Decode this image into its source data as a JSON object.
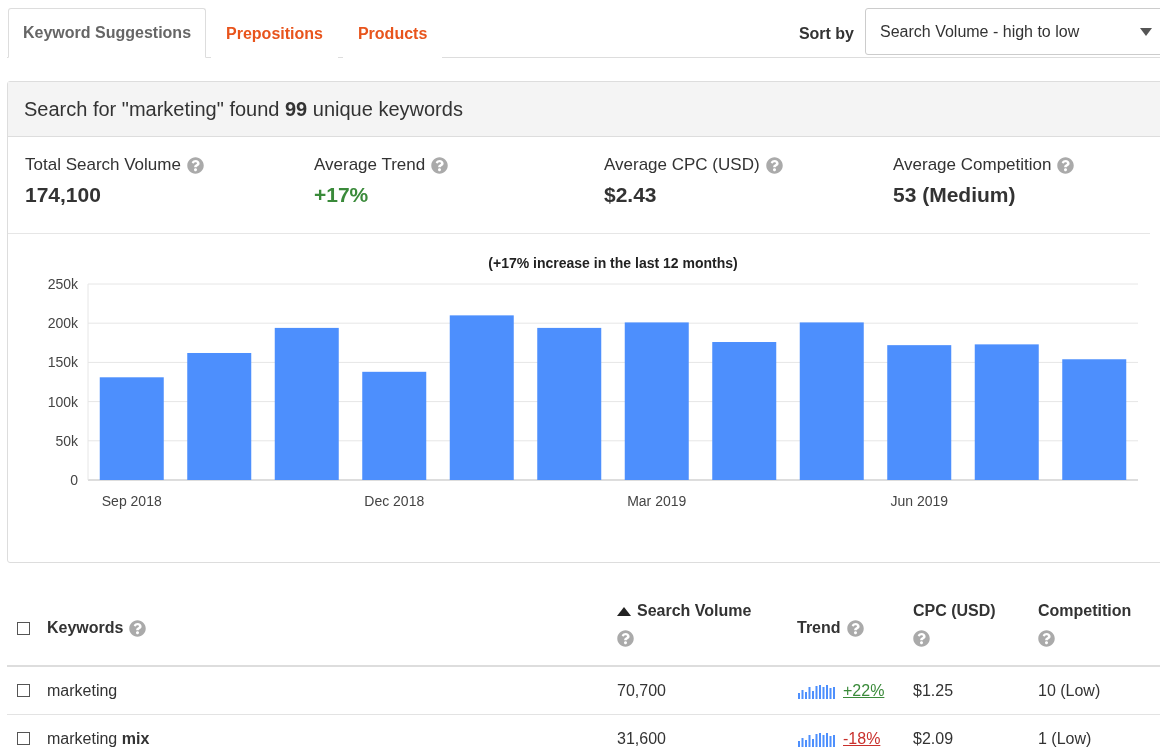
{
  "tabs": [
    {
      "label": "Keyword Suggestions",
      "selected": true
    },
    {
      "label": "Prepositions",
      "selected": false
    },
    {
      "label": "Products",
      "selected": false
    }
  ],
  "sort": {
    "label": "Sort by",
    "value": "Search Volume - high to low"
  },
  "summary": {
    "headline": "Search for \"marketing\" found **99** unique keywords",
    "stats": [
      {
        "label": "Total Search Volume",
        "value": "174,100",
        "kind": "plain"
      },
      {
        "label": "Average Trend",
        "value": "+17%",
        "kind": "positive"
      },
      {
        "label": "Average CPC (USD)",
        "value": "$2.43",
        "kind": "plain"
      },
      {
        "label": "Average Competition",
        "value": "53 (Medium)",
        "kind": "plain"
      }
    ],
    "chart_data": {
      "type": "bar",
      "title": "(+17% increase in the last 12 months)",
      "categories": [
        "Sep 2018",
        null,
        null,
        "Dec 2018",
        null,
        null,
        "Mar 2019",
        null,
        null,
        "Jun 2019",
        null,
        null
      ],
      "series": [
        {
          "color": "#4d8ffd",
          "values": [
            131000,
            162000,
            194000,
            138000,
            210000,
            194000,
            201000,
            176000,
            201000,
            172000,
            173000,
            154000
          ]
        }
      ],
      "ylim": [
        0,
        250000
      ],
      "grid": true,
      "yticks": [
        {
          "value": 0,
          "label": "0"
        },
        {
          "value": 50000,
          "label": "50k"
        },
        {
          "value": 100000,
          "label": "100k"
        },
        {
          "value": 150000,
          "label": "150k"
        },
        {
          "value": 200000,
          "label": "200k"
        },
        {
          "value": 250000,
          "label": "250k"
        }
      ]
    }
  },
  "table": {
    "select_all": {
      "checked": false
    },
    "columns": [
      {
        "label": "Keywords",
        "sorted": false
      },
      {
        "label": "Search Volume",
        "sorted": true
      },
      {
        "label": "Trend",
        "sorted": false
      },
      {
        "label": "CPC (USD)",
        "sorted": false
      },
      {
        "label": "Competition",
        "sorted": false
      }
    ],
    "rows": [
      {
        "checked": false,
        "keyword": "marketing",
        "volume": "70,700",
        "trend": "+22%",
        "trend_up": true,
        "cpc": "$1.25",
        "competition": "10 (Low)"
      },
      {
        "checked": false,
        "keyword": "marketing **mix**",
        "volume": "31,600",
        "trend": "-18%",
        "trend_up": false,
        "cpc": "$2.09",
        "competition": "1 (Low)"
      }
    ]
  }
}
